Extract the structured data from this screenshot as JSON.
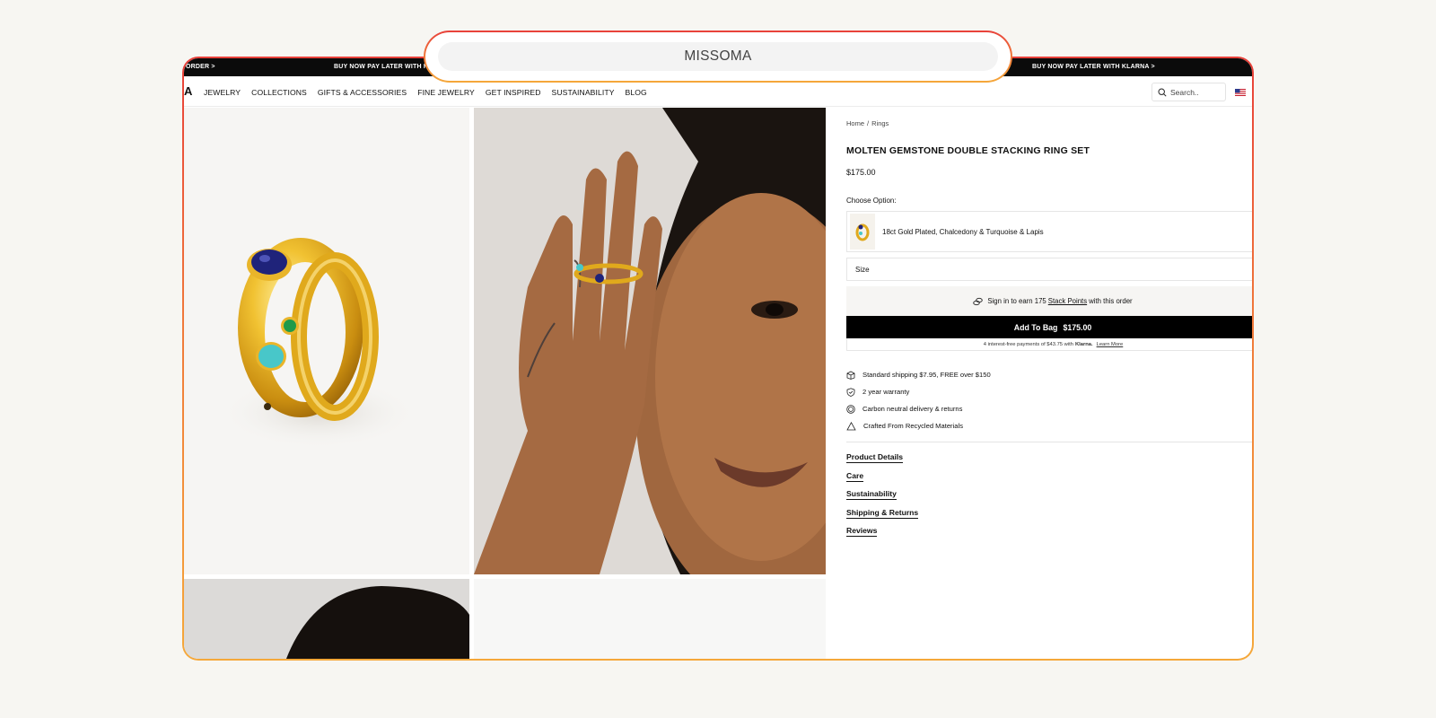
{
  "browser": {
    "url_title": "MISSOMA"
  },
  "promo_bar": {
    "left_text": "ORDER >",
    "center_text": "BUY NOW PAY LATER WITH K",
    "right_text": "BUY NOW PAY LATER WITH KLARNA >"
  },
  "nav": {
    "logo_fragment": "A",
    "items": [
      "JEWELRY",
      "COLLECTIONS",
      "GIFTS & ACCESSORIES",
      "FINE JEWELRY",
      "GET INSPIRED",
      "SUSTAINABILITY",
      "BLOG"
    ],
    "search_placeholder": "Search.."
  },
  "product": {
    "breadcrumb": [
      "Home",
      "Rings"
    ],
    "breadcrumb_sep": "/",
    "title": "MOLTEN GEMSTONE DOUBLE STACKING RING SET",
    "price": "$175.00",
    "choose_label": "Choose Option:",
    "option_label": "18ct Gold Plated, Chalcedony & Turquoise & Lapis",
    "size_label": "Size",
    "stack_points": {
      "prefix": "Sign in to earn 175",
      "link": "Stack Points",
      "suffix": "with this order"
    },
    "add_to_bag": {
      "label": "Add To Bag",
      "price": "$175.00"
    },
    "klarna": {
      "prefix": "4 interest-free payments of $43.75 with",
      "brand": "Klarna.",
      "link": "Learn More"
    },
    "features": [
      {
        "icon": "box-icon",
        "text": "Standard shipping $7.95, FREE over $150"
      },
      {
        "icon": "shield-icon",
        "text": "2 year warranty"
      },
      {
        "icon": "leaf-circle-icon",
        "text": "Carbon neutral delivery & returns"
      },
      {
        "icon": "recycle-icon",
        "text": "Crafted From Recycled Materials"
      }
    ],
    "info_links": [
      "Product Details",
      "Care",
      "Sustainability",
      "Shipping & Returns",
      "Reviews"
    ]
  },
  "colors": {
    "frame_gradient_top": "#e8403a",
    "frame_gradient_bottom": "#f5a83a",
    "add_to_bag_bg": "#000000",
    "ring_gold": "#e0a91c",
    "lapis": "#1f237a",
    "turquoise": "#48c7c9",
    "chalcedony": "#1f9a4a"
  }
}
